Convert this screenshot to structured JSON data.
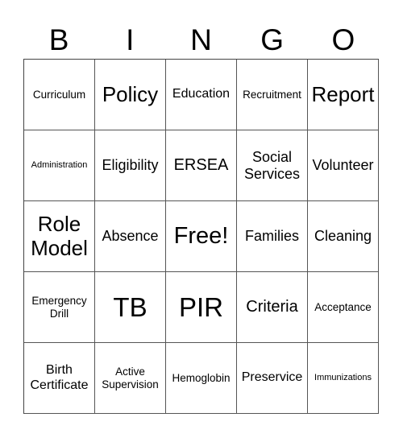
{
  "header": {
    "letters": [
      "B",
      "I",
      "N",
      "G",
      "O"
    ]
  },
  "board": {
    "rows": [
      [
        "Curriculum",
        "Policy",
        "Education",
        "Recruitment",
        "Report"
      ],
      [
        "Administration",
        "Eligibility",
        "ERSEA",
        "Social Services",
        "Volunteer"
      ],
      [
        "Role Model",
        "Absence",
        "Free!",
        "Families",
        "Cleaning"
      ],
      [
        "Emergency Drill",
        "TB",
        "PIR",
        "Criteria",
        "Acceptance"
      ],
      [
        "Birth Certificate",
        "Active Supervision",
        "Hemoglobin",
        "Preservice",
        "Immunizations"
      ]
    ],
    "free_space": "Free!"
  },
  "colors": {
    "grid_line": "#444444",
    "text": "#000000",
    "background": "#ffffff"
  }
}
